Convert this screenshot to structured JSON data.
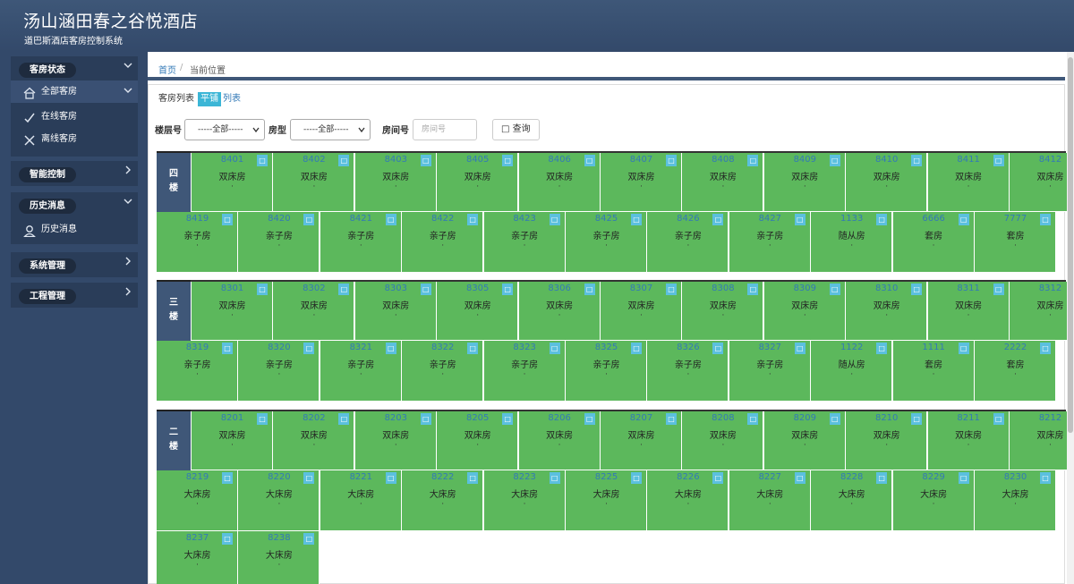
{
  "header": {
    "title": "汤山涵田春之谷悦酒店",
    "subtitle": "道巴斯酒店客房控制系统"
  },
  "sidebar": {
    "sections": [
      {
        "label": "客房状态",
        "expanded": true,
        "items": [
          {
            "label": "全部客房",
            "icon": "home-icon",
            "expandable": true
          },
          {
            "label": "在线客房",
            "icon": "check-icon"
          },
          {
            "label": "离线客房",
            "icon": "cross-icon"
          }
        ]
      },
      {
        "label": "智能控制",
        "expanded": false
      },
      {
        "label": "历史消息",
        "expanded": true,
        "items": [
          {
            "label": "历史消息",
            "icon": "user-icon"
          }
        ]
      },
      {
        "label": "系统管理",
        "expanded": false
      },
      {
        "label": "工程管理",
        "expanded": false
      }
    ]
  },
  "breadcrumb": {
    "home": "首页",
    "separator": "/",
    "current": "当前位置"
  },
  "view_tabs": {
    "list_prefix": "客房列表",
    "tile": "平铺",
    "list": "列表"
  },
  "filters": {
    "floor_label": "楼层号",
    "floor_value": "-----全部-----",
    "type_label": "房型",
    "type_value": "-----全部-----",
    "room_label": "房间号",
    "room_placeholder": "房间号",
    "search_icon": "□",
    "search_label": "查询"
  },
  "badge_glyph": "□",
  "dot": "·",
  "floors": [
    {
      "chars": [
        "四",
        "楼"
      ],
      "rows": [
        [
          {
            "n": "8401",
            "t": "双床房"
          },
          {
            "n": "8402",
            "t": "双床房"
          },
          {
            "n": "8403",
            "t": "双床房"
          },
          {
            "n": "8405",
            "t": "双床房"
          },
          {
            "n": "8406",
            "t": "双床房"
          },
          {
            "n": "8407",
            "t": "双床房"
          },
          {
            "n": "8408",
            "t": "双床房"
          },
          {
            "n": "8409",
            "t": "双床房"
          },
          {
            "n": "8410",
            "t": "双床房"
          },
          {
            "n": "8411",
            "t": "双床房"
          },
          {
            "n": "8412",
            "t": "双床房"
          }
        ],
        [
          {
            "n": "8419",
            "t": "亲子房"
          },
          {
            "n": "8420",
            "t": "亲子房"
          },
          {
            "n": "8421",
            "t": "亲子房"
          },
          {
            "n": "8422",
            "t": "亲子房"
          },
          {
            "n": "8423",
            "t": "亲子房"
          },
          {
            "n": "8425",
            "t": "亲子房"
          },
          {
            "n": "8426",
            "t": "亲子房"
          },
          {
            "n": "8427",
            "t": "亲子房"
          },
          {
            "n": "1133",
            "t": "随从房"
          },
          {
            "n": "6666",
            "t": "套房"
          },
          {
            "n": "7777",
            "t": "套房"
          }
        ]
      ]
    },
    {
      "chars": [
        "三",
        "楼"
      ],
      "rows": [
        [
          {
            "n": "8301",
            "t": "双床房"
          },
          {
            "n": "8302",
            "t": "双床房"
          },
          {
            "n": "8303",
            "t": "双床房"
          },
          {
            "n": "8305",
            "t": "双床房"
          },
          {
            "n": "8306",
            "t": "双床房"
          },
          {
            "n": "8307",
            "t": "双床房"
          },
          {
            "n": "8308",
            "t": "双床房"
          },
          {
            "n": "8309",
            "t": "双床房"
          },
          {
            "n": "8310",
            "t": "双床房"
          },
          {
            "n": "8311",
            "t": "双床房"
          },
          {
            "n": "8312",
            "t": "双床房"
          }
        ],
        [
          {
            "n": "8319",
            "t": "亲子房"
          },
          {
            "n": "8320",
            "t": "亲子房"
          },
          {
            "n": "8321",
            "t": "亲子房"
          },
          {
            "n": "8322",
            "t": "亲子房"
          },
          {
            "n": "8323",
            "t": "亲子房"
          },
          {
            "n": "8325",
            "t": "亲子房"
          },
          {
            "n": "8326",
            "t": "亲子房"
          },
          {
            "n": "8327",
            "t": "亲子房"
          },
          {
            "n": "1122",
            "t": "随从房"
          },
          {
            "n": "1111",
            "t": "套房"
          },
          {
            "n": "2222",
            "t": "套房"
          }
        ]
      ]
    },
    {
      "chars": [
        "二",
        "楼"
      ],
      "rows": [
        [
          {
            "n": "8201",
            "t": "双床房"
          },
          {
            "n": "8202",
            "t": "双床房"
          },
          {
            "n": "8203",
            "t": "双床房"
          },
          {
            "n": "8205",
            "t": "双床房"
          },
          {
            "n": "8206",
            "t": "双床房"
          },
          {
            "n": "8207",
            "t": "双床房"
          },
          {
            "n": "8208",
            "t": "双床房"
          },
          {
            "n": "8209",
            "t": "双床房"
          },
          {
            "n": "8210",
            "t": "双床房"
          },
          {
            "n": "8211",
            "t": "双床房"
          },
          {
            "n": "8212",
            "t": "双床房"
          }
        ],
        [
          {
            "n": "8219",
            "t": "大床房"
          },
          {
            "n": "8220",
            "t": "大床房"
          },
          {
            "n": "8221",
            "t": "大床房"
          },
          {
            "n": "8222",
            "t": "大床房"
          },
          {
            "n": "8223",
            "t": "大床房"
          },
          {
            "n": "8225",
            "t": "大床房"
          },
          {
            "n": "8226",
            "t": "大床房"
          },
          {
            "n": "8227",
            "t": "大床房"
          },
          {
            "n": "8228",
            "t": "大床房"
          },
          {
            "n": "8229",
            "t": "大床房"
          },
          {
            "n": "8230",
            "t": "大床房"
          }
        ],
        [
          {
            "n": "8237",
            "t": "大床房"
          },
          {
            "n": "8238",
            "t": "大床房"
          }
        ]
      ]
    }
  ]
}
